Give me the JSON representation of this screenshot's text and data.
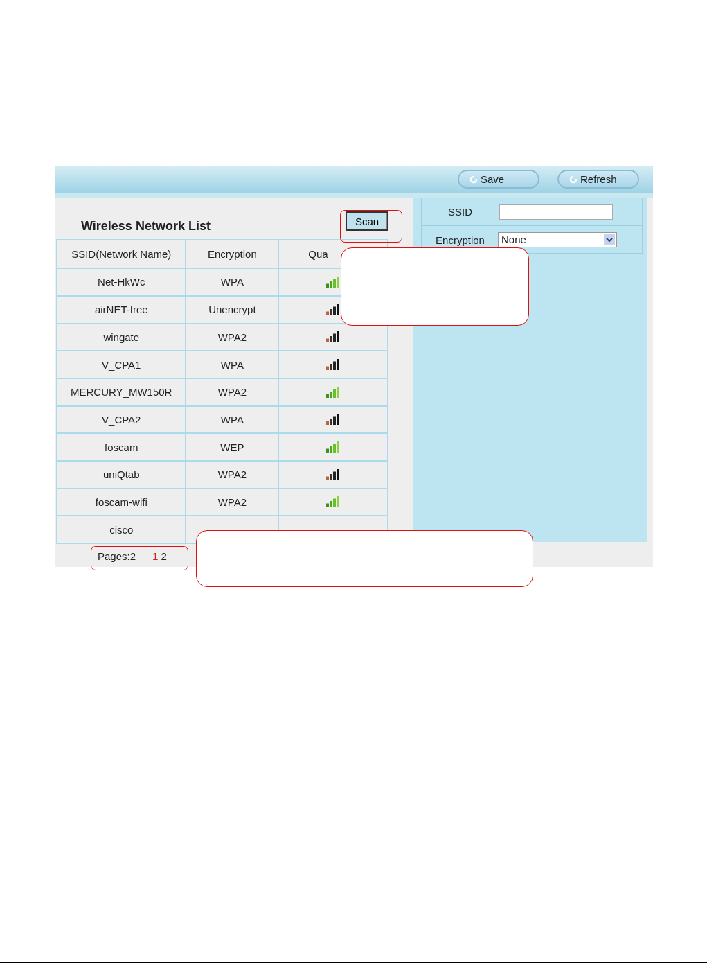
{
  "toolbar": {
    "buttons": [
      {
        "label": "Save"
      },
      {
        "label": "Refresh"
      }
    ]
  },
  "network_list": {
    "title": "Wireless Network List",
    "scan_button": "Scan",
    "columns": [
      "SSID(Network Name)",
      "Encryption",
      "Qua"
    ],
    "rows": [
      {
        "ssid": "Net-HkWc",
        "encryption": "WPA",
        "kind": "green"
      },
      {
        "ssid": "airNET-free",
        "encryption": "Unencrypt",
        "kind": "dark"
      },
      {
        "ssid": "wingate",
        "encryption": "WPA2",
        "kind": "dark"
      },
      {
        "ssid": "V_CPA1",
        "encryption": "WPA",
        "kind": "dark"
      },
      {
        "ssid": "MERCURY_MW150R",
        "encryption": "WPA2",
        "kind": "green"
      },
      {
        "ssid": "V_CPA2",
        "encryption": "WPA",
        "kind": "dark"
      },
      {
        "ssid": "foscam",
        "encryption": "WEP",
        "kind": "green"
      },
      {
        "ssid": "uniQtab",
        "encryption": "WPA2",
        "kind": "dark"
      },
      {
        "ssid": "foscam-wifi",
        "encryption": "WPA2",
        "kind": "green"
      },
      {
        "ssid": "cisco"
      }
    ],
    "pages_label": "Pages:2",
    "pages": [
      {
        "label": "1",
        "selected": true
      },
      {
        "label": "2",
        "selected": false
      }
    ]
  },
  "settings": {
    "ssid_label": "SSID",
    "encryption_label": "Encryption",
    "encryption_value": "None"
  }
}
